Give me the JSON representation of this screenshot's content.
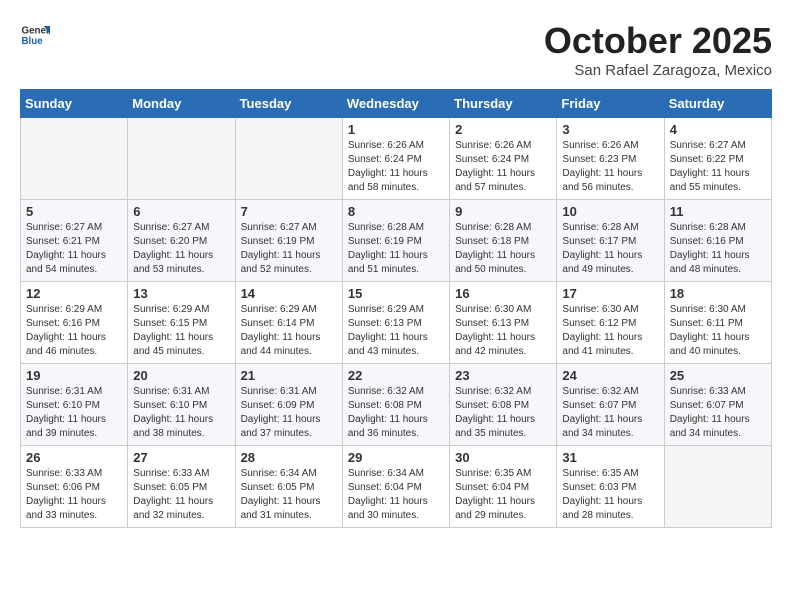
{
  "header": {
    "logo_general": "General",
    "logo_blue": "Blue",
    "month": "October 2025",
    "location": "San Rafael Zaragoza, Mexico"
  },
  "weekdays": [
    "Sunday",
    "Monday",
    "Tuesday",
    "Wednesday",
    "Thursday",
    "Friday",
    "Saturday"
  ],
  "rows": [
    [
      {
        "day": "",
        "info": ""
      },
      {
        "day": "",
        "info": ""
      },
      {
        "day": "",
        "info": ""
      },
      {
        "day": "1",
        "info": "Sunrise: 6:26 AM\nSunset: 6:24 PM\nDaylight: 11 hours\nand 58 minutes."
      },
      {
        "day": "2",
        "info": "Sunrise: 6:26 AM\nSunset: 6:24 PM\nDaylight: 11 hours\nand 57 minutes."
      },
      {
        "day": "3",
        "info": "Sunrise: 6:26 AM\nSunset: 6:23 PM\nDaylight: 11 hours\nand 56 minutes."
      },
      {
        "day": "4",
        "info": "Sunrise: 6:27 AM\nSunset: 6:22 PM\nDaylight: 11 hours\nand 55 minutes."
      }
    ],
    [
      {
        "day": "5",
        "info": "Sunrise: 6:27 AM\nSunset: 6:21 PM\nDaylight: 11 hours\nand 54 minutes."
      },
      {
        "day": "6",
        "info": "Sunrise: 6:27 AM\nSunset: 6:20 PM\nDaylight: 11 hours\nand 53 minutes."
      },
      {
        "day": "7",
        "info": "Sunrise: 6:27 AM\nSunset: 6:19 PM\nDaylight: 11 hours\nand 52 minutes."
      },
      {
        "day": "8",
        "info": "Sunrise: 6:28 AM\nSunset: 6:19 PM\nDaylight: 11 hours\nand 51 minutes."
      },
      {
        "day": "9",
        "info": "Sunrise: 6:28 AM\nSunset: 6:18 PM\nDaylight: 11 hours\nand 50 minutes."
      },
      {
        "day": "10",
        "info": "Sunrise: 6:28 AM\nSunset: 6:17 PM\nDaylight: 11 hours\nand 49 minutes."
      },
      {
        "day": "11",
        "info": "Sunrise: 6:28 AM\nSunset: 6:16 PM\nDaylight: 11 hours\nand 48 minutes."
      }
    ],
    [
      {
        "day": "12",
        "info": "Sunrise: 6:29 AM\nSunset: 6:16 PM\nDaylight: 11 hours\nand 46 minutes."
      },
      {
        "day": "13",
        "info": "Sunrise: 6:29 AM\nSunset: 6:15 PM\nDaylight: 11 hours\nand 45 minutes."
      },
      {
        "day": "14",
        "info": "Sunrise: 6:29 AM\nSunset: 6:14 PM\nDaylight: 11 hours\nand 44 minutes."
      },
      {
        "day": "15",
        "info": "Sunrise: 6:29 AM\nSunset: 6:13 PM\nDaylight: 11 hours\nand 43 minutes."
      },
      {
        "day": "16",
        "info": "Sunrise: 6:30 AM\nSunset: 6:13 PM\nDaylight: 11 hours\nand 42 minutes."
      },
      {
        "day": "17",
        "info": "Sunrise: 6:30 AM\nSunset: 6:12 PM\nDaylight: 11 hours\nand 41 minutes."
      },
      {
        "day": "18",
        "info": "Sunrise: 6:30 AM\nSunset: 6:11 PM\nDaylight: 11 hours\nand 40 minutes."
      }
    ],
    [
      {
        "day": "19",
        "info": "Sunrise: 6:31 AM\nSunset: 6:10 PM\nDaylight: 11 hours\nand 39 minutes."
      },
      {
        "day": "20",
        "info": "Sunrise: 6:31 AM\nSunset: 6:10 PM\nDaylight: 11 hours\nand 38 minutes."
      },
      {
        "day": "21",
        "info": "Sunrise: 6:31 AM\nSunset: 6:09 PM\nDaylight: 11 hours\nand 37 minutes."
      },
      {
        "day": "22",
        "info": "Sunrise: 6:32 AM\nSunset: 6:08 PM\nDaylight: 11 hours\nand 36 minutes."
      },
      {
        "day": "23",
        "info": "Sunrise: 6:32 AM\nSunset: 6:08 PM\nDaylight: 11 hours\nand 35 minutes."
      },
      {
        "day": "24",
        "info": "Sunrise: 6:32 AM\nSunset: 6:07 PM\nDaylight: 11 hours\nand 34 minutes."
      },
      {
        "day": "25",
        "info": "Sunrise: 6:33 AM\nSunset: 6:07 PM\nDaylight: 11 hours\nand 34 minutes."
      }
    ],
    [
      {
        "day": "26",
        "info": "Sunrise: 6:33 AM\nSunset: 6:06 PM\nDaylight: 11 hours\nand 33 minutes."
      },
      {
        "day": "27",
        "info": "Sunrise: 6:33 AM\nSunset: 6:05 PM\nDaylight: 11 hours\nand 32 minutes."
      },
      {
        "day": "28",
        "info": "Sunrise: 6:34 AM\nSunset: 6:05 PM\nDaylight: 11 hours\nand 31 minutes."
      },
      {
        "day": "29",
        "info": "Sunrise: 6:34 AM\nSunset: 6:04 PM\nDaylight: 11 hours\nand 30 minutes."
      },
      {
        "day": "30",
        "info": "Sunrise: 6:35 AM\nSunset: 6:04 PM\nDaylight: 11 hours\nand 29 minutes."
      },
      {
        "day": "31",
        "info": "Sunrise: 6:35 AM\nSunset: 6:03 PM\nDaylight: 11 hours\nand 28 minutes."
      },
      {
        "day": "",
        "info": ""
      }
    ]
  ]
}
